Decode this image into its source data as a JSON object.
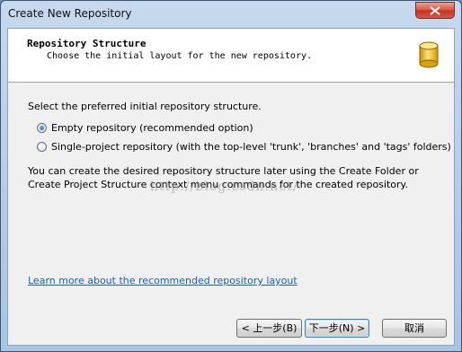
{
  "window": {
    "title": "Create New Repository"
  },
  "header": {
    "title": "Repository Structure",
    "subtitle": "Choose the initial layout for the new repository."
  },
  "content": {
    "prompt": "Select the preferred initial repository structure.",
    "options": [
      {
        "label": "Empty repository (recommended option)",
        "selected": true
      },
      {
        "label": "Single-project repository (with the top-level 'trunk', 'branches' and 'tags' folders)",
        "selected": false
      }
    ],
    "note": "You can create the desired repository structure later using the Create Folder or Create Project Structure context menu commands for the created repository.",
    "link": "Learn more about the recommended repository layout",
    "watermark": "http://blog.csdn.net/"
  },
  "buttons": {
    "back": "< 上一步(B)",
    "next": "下一步(N) >",
    "cancel": "取消"
  },
  "colors": {
    "link": "#1a5fb4",
    "header_bg": "#ffffff",
    "dialog_bg": "#f0f0f0",
    "close_button": "#c3321f"
  },
  "icons": {
    "header": "database-icon",
    "close": "close-icon"
  }
}
